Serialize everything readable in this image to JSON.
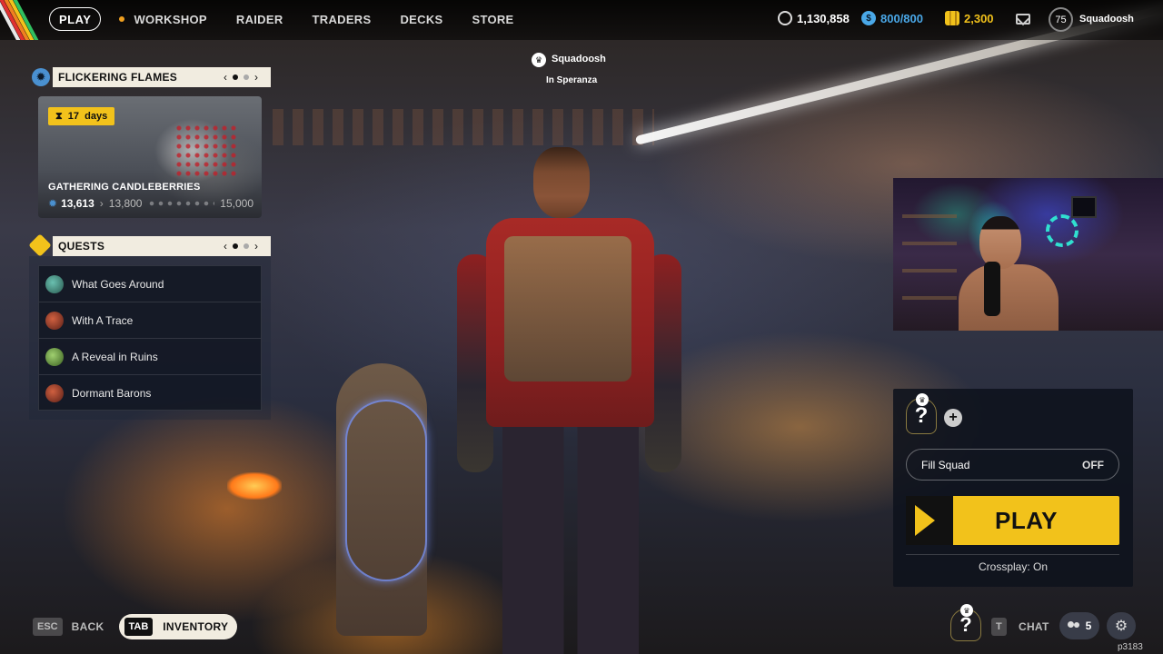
{
  "nav": {
    "play": "PLAY",
    "items": [
      "WORKSHOP",
      "RAIDER",
      "TRADERS",
      "DECKS",
      "STORE"
    ]
  },
  "currencies": [
    {
      "icon": "coins-icon",
      "value": "1,130,858"
    },
    {
      "icon": "credits-icon",
      "value": "800/800",
      "color": "#4aa8e8"
    },
    {
      "icon": "gold-bars-icon",
      "value": "2,300",
      "color": "#f2c21b"
    }
  ],
  "profile": {
    "level": "75",
    "username": "Squadoosh"
  },
  "event": {
    "title": "FLICKERING FLAMES",
    "days_value": "17",
    "days_unit": "days",
    "name": "GATHERING CANDLEBERRIES",
    "progress_current": "13,613",
    "progress_next": "13,800",
    "progress_max": "15,000"
  },
  "quests": {
    "title": "QUESTS",
    "items": [
      {
        "label": "What Goes Around",
        "color": "#3a9a8a"
      },
      {
        "label": "With A Trace",
        "color": "#b04030"
      },
      {
        "label": "A Reveal in Ruins",
        "color": "#6aa040"
      },
      {
        "label": "Dormant Barons",
        "color": "#b04030"
      }
    ]
  },
  "player": {
    "name": "Squadoosh",
    "location": "In Speranza"
  },
  "squad": {
    "slot_symbol": "?",
    "add_symbol": "+",
    "fill_label": "Fill Squad",
    "fill_value": "OFF",
    "play_label": "PLAY",
    "crossplay": "Crossplay: On"
  },
  "bottom": {
    "esc_key": "ESC",
    "back": "BACK",
    "tab_key": "TAB",
    "inventory": "INVENTORY",
    "slot_symbol": "?",
    "chat_key": "T",
    "chat": "CHAT",
    "friends_count": "5",
    "build": "p3183"
  },
  "colors": {
    "accent": "#f2c21b",
    "panel_header": "#f1ece0"
  }
}
